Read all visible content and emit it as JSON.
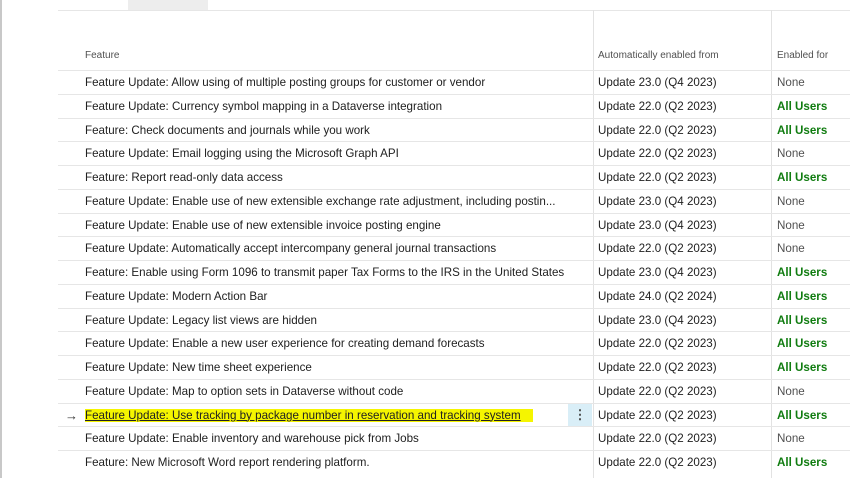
{
  "columns": {
    "feature": "Feature",
    "auto_enabled_from": "Automatically enabled from",
    "enabled_for": "Enabled for"
  },
  "rows": [
    {
      "feature": "Feature Update: Allow using of multiple posting groups for customer or vendor",
      "update": "Update 23.0 (Q4 2023)",
      "enabled_for": "None"
    },
    {
      "feature": "Feature Update: Currency symbol mapping in a Dataverse integration",
      "update": "Update 22.0 (Q2 2023)",
      "enabled_for": "All Users"
    },
    {
      "feature": "Feature: Check documents and journals while you work",
      "update": "Update 22.0 (Q2 2023)",
      "enabled_for": "All Users"
    },
    {
      "feature": "Feature Update: Email logging using the Microsoft Graph API",
      "update": "Update 22.0 (Q2 2023)",
      "enabled_for": "None"
    },
    {
      "feature": "Feature: Report read-only data access",
      "update": "Update 22.0 (Q2 2023)",
      "enabled_for": "All Users"
    },
    {
      "feature": "Feature Update: Enable use of new extensible exchange rate adjustment, including postin...",
      "update": "Update 23.0 (Q4 2023)",
      "enabled_for": "None"
    },
    {
      "feature": "Feature Update: Enable use of new extensible invoice posting engine",
      "update": "Update 23.0 (Q4 2023)",
      "enabled_for": "None"
    },
    {
      "feature": "Feature Update: Automatically accept intercompany general journal transactions",
      "update": "Update 22.0 (Q2 2023)",
      "enabled_for": "None"
    },
    {
      "feature": "Feature: Enable using Form 1096 to transmit paper Tax Forms to the IRS in the United States",
      "update": "Update 23.0 (Q4 2023)",
      "enabled_for": "All Users"
    },
    {
      "feature": "Feature Update: Modern Action Bar",
      "update": "Update 24.0 (Q2 2024)",
      "enabled_for": "All Users"
    },
    {
      "feature": "Feature Update: Legacy list views are hidden",
      "update": "Update 23.0 (Q4 2023)",
      "enabled_for": "All Users"
    },
    {
      "feature": "Feature Update: Enable a new user experience for creating demand forecasts",
      "update": "Update 22.0 (Q2 2023)",
      "enabled_for": "All Users"
    },
    {
      "feature": "Feature Update: New time sheet experience",
      "update": "Update 22.0 (Q2 2023)",
      "enabled_for": "All Users"
    },
    {
      "feature": "Feature Update: Map to option sets in Dataverse without code",
      "update": "Update 22.0 (Q2 2023)",
      "enabled_for": "None"
    },
    {
      "feature": "Feature Update: Use tracking by package number in reservation and tracking system",
      "update": "Update 22.0 (Q2 2023)",
      "enabled_for": "All Users",
      "selected": true
    },
    {
      "feature": "Feature Update: Enable inventory and warehouse pick from Jobs",
      "update": "Update 22.0 (Q2 2023)",
      "enabled_for": "None"
    },
    {
      "feature": "Feature: New Microsoft Word report rendering platform.",
      "update": "Update 22.0 (Q2 2023)",
      "enabled_for": "All Users"
    }
  ],
  "selected_row_marker": "→",
  "row_menu_glyph": "⋮",
  "colors": {
    "all_users": "#107c10",
    "highlight": "#f5f500",
    "row_menu_bg": "#d9eef7"
  }
}
